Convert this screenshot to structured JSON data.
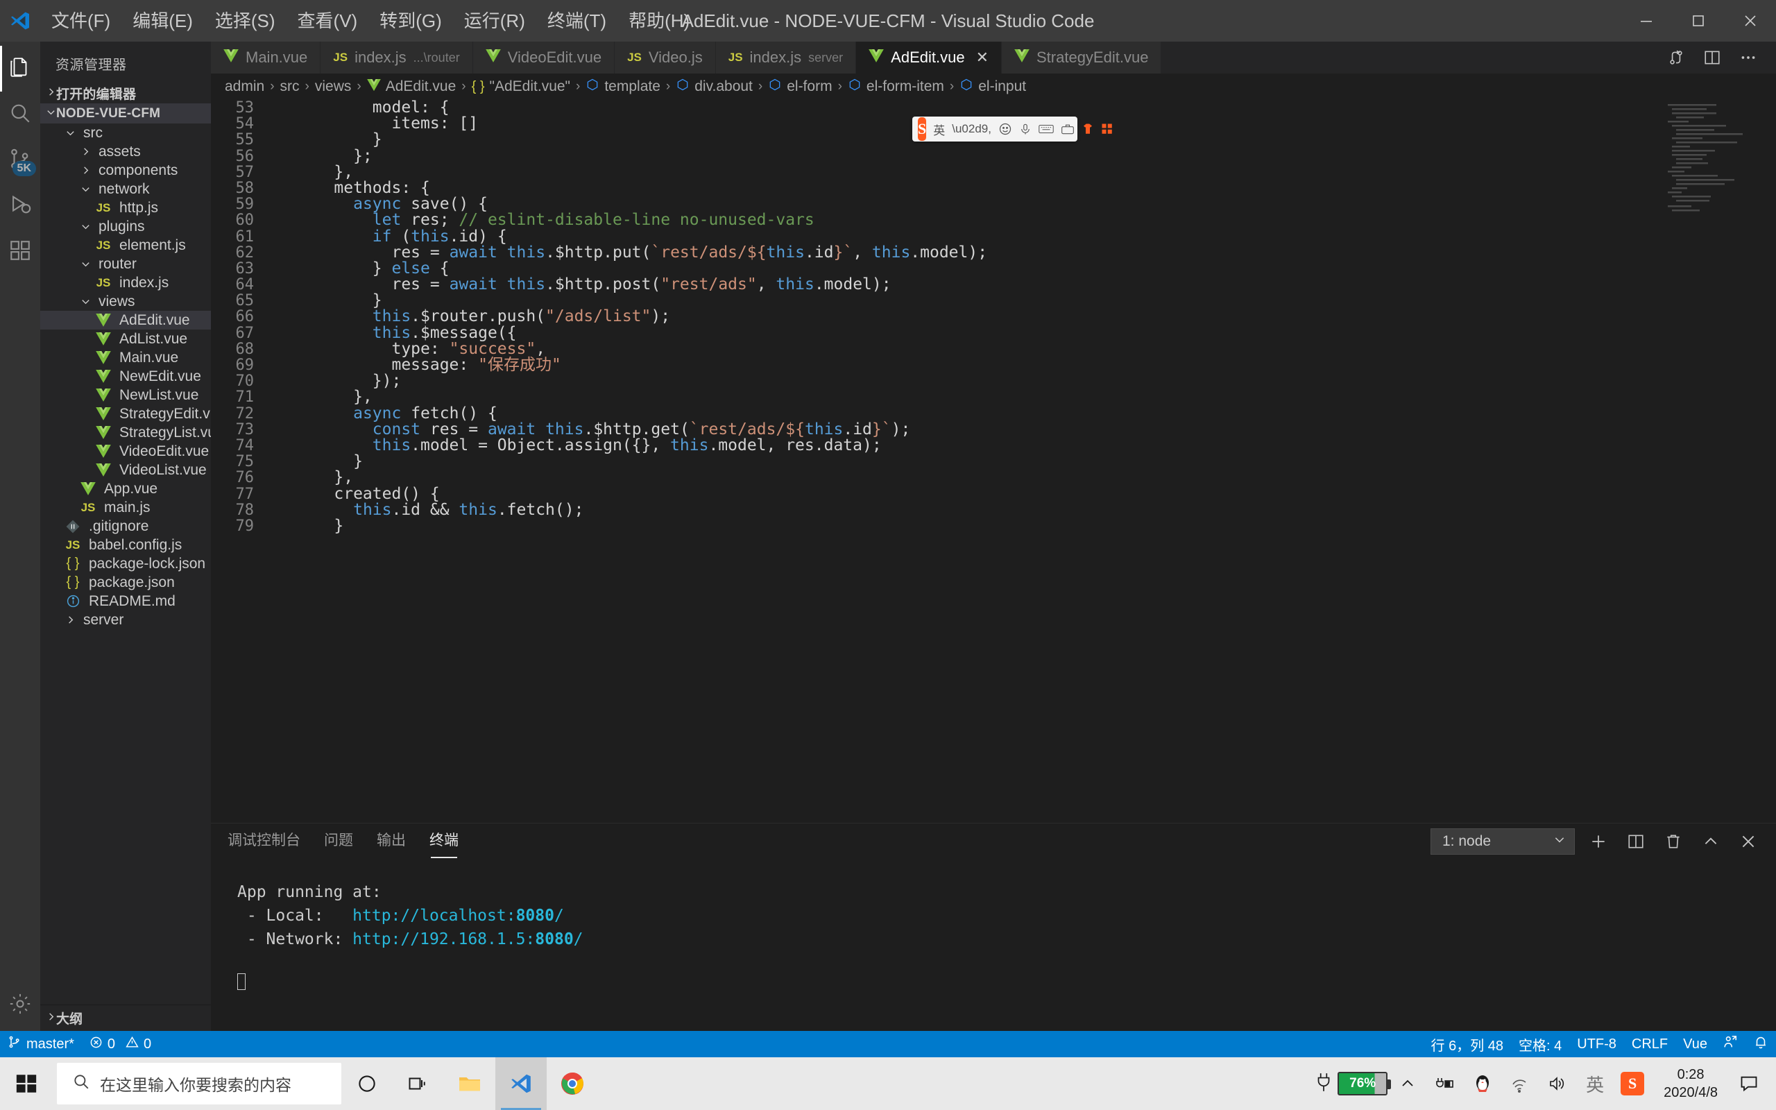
{
  "window": {
    "title": "AdEdit.vue - NODE-VUE-CFM - Visual Studio Code",
    "minimize": "—",
    "maximize": "❐",
    "close": "✕"
  },
  "menu": [
    {
      "label": "文件(F)",
      "name": "menu-file"
    },
    {
      "label": "编辑(E)",
      "name": "menu-edit"
    },
    {
      "label": "选择(S)",
      "name": "menu-selection"
    },
    {
      "label": "查看(V)",
      "name": "menu-view"
    },
    {
      "label": "转到(G)",
      "name": "menu-go"
    },
    {
      "label": "运行(R)",
      "name": "menu-run"
    },
    {
      "label": "终端(T)",
      "name": "menu-terminal"
    },
    {
      "label": "帮助(H)",
      "name": "menu-help"
    }
  ],
  "activitybar": {
    "source_control_badge": "5K"
  },
  "sidebar": {
    "title": "资源管理器",
    "sections": [
      {
        "label": "打开的编辑器",
        "expanded": false
      },
      {
        "label": "NODE-VUE-CFM",
        "expanded": true
      }
    ],
    "outline_label": "大纲",
    "tree": [
      {
        "label": "src",
        "indent": 1,
        "type": "folder",
        "expanded": true,
        "selected": false
      },
      {
        "label": "assets",
        "indent": 2,
        "type": "folder",
        "expanded": false,
        "selected": false
      },
      {
        "label": "components",
        "indent": 2,
        "type": "folder",
        "expanded": false,
        "selected": false
      },
      {
        "label": "network",
        "indent": 2,
        "type": "folder",
        "expanded": true,
        "selected": false
      },
      {
        "label": "http.js",
        "indent": 3,
        "type": "js",
        "selected": false
      },
      {
        "label": "plugins",
        "indent": 2,
        "type": "folder",
        "expanded": true,
        "selected": false
      },
      {
        "label": "element.js",
        "indent": 3,
        "type": "js",
        "selected": false
      },
      {
        "label": "router",
        "indent": 2,
        "type": "folder",
        "expanded": true,
        "selected": false
      },
      {
        "label": "index.js",
        "indent": 3,
        "type": "js",
        "selected": false
      },
      {
        "label": "views",
        "indent": 2,
        "type": "folder",
        "expanded": true,
        "selected": false
      },
      {
        "label": "AdEdit.vue",
        "indent": 3,
        "type": "vue",
        "selected": true
      },
      {
        "label": "AdList.vue",
        "indent": 3,
        "type": "vue",
        "selected": false
      },
      {
        "label": "Main.vue",
        "indent": 3,
        "type": "vue",
        "selected": false
      },
      {
        "label": "NewEdit.vue",
        "indent": 3,
        "type": "vue",
        "selected": false
      },
      {
        "label": "NewList.vue",
        "indent": 3,
        "type": "vue",
        "selected": false
      },
      {
        "label": "StrategyEdit.vue",
        "indent": 3,
        "type": "vue",
        "selected": false
      },
      {
        "label": "StrategyList.vue",
        "indent": 3,
        "type": "vue",
        "selected": false
      },
      {
        "label": "VideoEdit.vue",
        "indent": 3,
        "type": "vue",
        "selected": false
      },
      {
        "label": "VideoList.vue",
        "indent": 3,
        "type": "vue",
        "selected": false
      },
      {
        "label": "App.vue",
        "indent": 2,
        "type": "vue",
        "selected": false
      },
      {
        "label": "main.js",
        "indent": 2,
        "type": "js",
        "selected": false
      },
      {
        "label": ".gitignore",
        "indent": 1,
        "type": "git",
        "selected": false
      },
      {
        "label": "babel.config.js",
        "indent": 1,
        "type": "js",
        "selected": false
      },
      {
        "label": "package-lock.json",
        "indent": 1,
        "type": "json",
        "selected": false
      },
      {
        "label": "package.json",
        "indent": 1,
        "type": "json",
        "selected": false
      },
      {
        "label": "README.md",
        "indent": 1,
        "type": "info",
        "selected": false
      },
      {
        "label": "server",
        "indent": 1,
        "type": "folder",
        "expanded": false,
        "selected": false
      }
    ]
  },
  "tabs": [
    {
      "label": "Main.vue",
      "icon": "vue",
      "dim": "",
      "active": false,
      "closable": false
    },
    {
      "label": "index.js",
      "icon": "js",
      "dim": "...\\router",
      "active": false,
      "closable": false
    },
    {
      "label": "VideoEdit.vue",
      "icon": "vue",
      "dim": "",
      "active": false,
      "closable": false
    },
    {
      "label": "Video.js",
      "icon": "js",
      "dim": "",
      "active": false,
      "closable": false
    },
    {
      "label": "index.js",
      "icon": "js",
      "dim": "server",
      "active": false,
      "closable": false
    },
    {
      "label": "AdEdit.vue",
      "icon": "vue",
      "dim": "",
      "active": true,
      "closable": true
    },
    {
      "label": "StrategyEdit.vue",
      "icon": "vue",
      "dim": "",
      "active": false,
      "closable": false
    }
  ],
  "breadcrumb": [
    {
      "label": "admin",
      "icon": "none"
    },
    {
      "label": "src",
      "icon": "none"
    },
    {
      "label": "views",
      "icon": "none"
    },
    {
      "label": "AdEdit.vue",
      "icon": "vue"
    },
    {
      "label": "\"AdEdit.vue\"",
      "icon": "json"
    },
    {
      "label": "template",
      "icon": "cube"
    },
    {
      "label": "div.about",
      "icon": "cube"
    },
    {
      "label": "el-form",
      "icon": "cube"
    },
    {
      "label": "el-form-item",
      "icon": "cube"
    },
    {
      "label": "el-input",
      "icon": "cube"
    }
  ],
  "code": {
    "first_visible_line": 53,
    "lines": [
      {
        "n": 53,
        "tokens": [
          {
            "t": "        model: {",
            "c": "pun"
          }
        ],
        "clipped": true
      },
      {
        "n": 54,
        "tokens": [
          {
            "t": "          items: []",
            "c": "pun"
          }
        ]
      },
      {
        "n": 55,
        "tokens": [
          {
            "t": "        }",
            "c": "pun"
          }
        ]
      },
      {
        "n": 56,
        "tokens": [
          {
            "t": "      };",
            "c": "pun"
          }
        ]
      },
      {
        "n": 57,
        "tokens": [
          {
            "t": "    },",
            "c": "pun"
          }
        ]
      },
      {
        "n": 58,
        "tokens": [
          {
            "t": "    methods: {",
            "c": "pun"
          }
        ]
      },
      {
        "n": 59,
        "tokens": [
          {
            "t": "      ",
            "c": "pun"
          },
          {
            "t": "async",
            "c": "kw"
          },
          {
            "t": " save() {",
            "c": "pun"
          }
        ]
      },
      {
        "n": 60,
        "tokens": [
          {
            "t": "        ",
            "c": "pun"
          },
          {
            "t": "let",
            "c": "kw"
          },
          {
            "t": " res; ",
            "c": "pun"
          },
          {
            "t": "// eslint-disable-line no-unused-vars",
            "c": "cmt"
          }
        ]
      },
      {
        "n": 61,
        "tokens": [
          {
            "t": "        ",
            "c": "pun"
          },
          {
            "t": "if",
            "c": "kw"
          },
          {
            "t": " (",
            "c": "pun"
          },
          {
            "t": "this",
            "c": "kw"
          },
          {
            "t": ".id) {",
            "c": "pun"
          }
        ]
      },
      {
        "n": 62,
        "tokens": [
          {
            "t": "          res = ",
            "c": "pun"
          },
          {
            "t": "await",
            "c": "kw"
          },
          {
            "t": " ",
            "c": "pun"
          },
          {
            "t": "this",
            "c": "kw"
          },
          {
            "t": ".$http.put(",
            "c": "pun"
          },
          {
            "t": "`rest/ads/${",
            "c": "str"
          },
          {
            "t": "this",
            "c": "kw"
          },
          {
            "t": ".id",
            "c": "pun"
          },
          {
            "t": "}`",
            "c": "str"
          },
          {
            "t": ", ",
            "c": "pun"
          },
          {
            "t": "this",
            "c": "kw"
          },
          {
            "t": ".model);",
            "c": "pun"
          }
        ]
      },
      {
        "n": 63,
        "tokens": [
          {
            "t": "        } ",
            "c": "pun"
          },
          {
            "t": "else",
            "c": "kw"
          },
          {
            "t": " {",
            "c": "pun"
          }
        ]
      },
      {
        "n": 64,
        "tokens": [
          {
            "t": "          res = ",
            "c": "pun"
          },
          {
            "t": "await",
            "c": "kw"
          },
          {
            "t": " ",
            "c": "pun"
          },
          {
            "t": "this",
            "c": "kw"
          },
          {
            "t": ".$http.post(",
            "c": "pun"
          },
          {
            "t": "\"rest/ads\"",
            "c": "str"
          },
          {
            "t": ", ",
            "c": "pun"
          },
          {
            "t": "this",
            "c": "kw"
          },
          {
            "t": ".model);",
            "c": "pun"
          }
        ]
      },
      {
        "n": 65,
        "tokens": [
          {
            "t": "        }",
            "c": "pun"
          }
        ]
      },
      {
        "n": 66,
        "tokens": [
          {
            "t": "        ",
            "c": "pun"
          },
          {
            "t": "this",
            "c": "kw"
          },
          {
            "t": ".$router.push(",
            "c": "pun"
          },
          {
            "t": "\"/ads/list\"",
            "c": "str"
          },
          {
            "t": ");",
            "c": "pun"
          }
        ]
      },
      {
        "n": 67,
        "tokens": [
          {
            "t": "        ",
            "c": "pun"
          },
          {
            "t": "this",
            "c": "kw"
          },
          {
            "t": ".$message({",
            "c": "pun"
          }
        ]
      },
      {
        "n": 68,
        "tokens": [
          {
            "t": "          type: ",
            "c": "pun"
          },
          {
            "t": "\"success\"",
            "c": "str"
          },
          {
            "t": ",",
            "c": "pun"
          }
        ]
      },
      {
        "n": 69,
        "tokens": [
          {
            "t": "          message: ",
            "c": "pun"
          },
          {
            "t": "\"保存成功\"",
            "c": "str"
          }
        ]
      },
      {
        "n": 70,
        "tokens": [
          {
            "t": "        });",
            "c": "pun"
          }
        ]
      },
      {
        "n": 71,
        "tokens": [
          {
            "t": "      },",
            "c": "pun"
          }
        ]
      },
      {
        "n": 72,
        "tokens": [
          {
            "t": "      ",
            "c": "pun"
          },
          {
            "t": "async",
            "c": "kw"
          },
          {
            "t": " fetch() {",
            "c": "pun"
          }
        ]
      },
      {
        "n": 73,
        "tokens": [
          {
            "t": "        ",
            "c": "pun"
          },
          {
            "t": "const",
            "c": "kw"
          },
          {
            "t": " res = ",
            "c": "pun"
          },
          {
            "t": "await",
            "c": "kw"
          },
          {
            "t": " ",
            "c": "pun"
          },
          {
            "t": "this",
            "c": "kw"
          },
          {
            "t": ".$http.get(",
            "c": "pun"
          },
          {
            "t": "`rest/ads/${",
            "c": "str"
          },
          {
            "t": "this",
            "c": "kw"
          },
          {
            "t": ".id",
            "c": "pun"
          },
          {
            "t": "}`",
            "c": "str"
          },
          {
            "t": ");",
            "c": "pun"
          }
        ]
      },
      {
        "n": 74,
        "tokens": [
          {
            "t": "        ",
            "c": "pun"
          },
          {
            "t": "this",
            "c": "kw"
          },
          {
            "t": ".model = Object.assign({}, ",
            "c": "pun"
          },
          {
            "t": "this",
            "c": "kw"
          },
          {
            "t": ".model, res.data);",
            "c": "pun"
          }
        ]
      },
      {
        "n": 75,
        "tokens": [
          {
            "t": "      }",
            "c": "pun"
          }
        ]
      },
      {
        "n": 76,
        "tokens": [
          {
            "t": "    },",
            "c": "pun"
          }
        ]
      },
      {
        "n": 77,
        "tokens": [
          {
            "t": "    created() {",
            "c": "pun"
          }
        ]
      },
      {
        "n": 78,
        "tokens": [
          {
            "t": "      ",
            "c": "pun"
          },
          {
            "t": "this",
            "c": "kw"
          },
          {
            "t": ".id && ",
            "c": "pun"
          },
          {
            "t": "this",
            "c": "kw"
          },
          {
            "t": ".fetch();",
            "c": "pun"
          }
        ]
      },
      {
        "n": 79,
        "tokens": [
          {
            "t": "    }",
            "c": "pun"
          }
        ],
        "clipped": true
      }
    ]
  },
  "panel": {
    "tabs": [
      {
        "label": "调试控制台",
        "active": false
      },
      {
        "label": "问题",
        "active": false
      },
      {
        "label": "输出",
        "active": false
      },
      {
        "label": "终端",
        "active": true
      }
    ],
    "terminal_select": "1: node",
    "terminal_lines": [
      {
        "segments": [
          {
            "t": "App running at:",
            "c": "plain"
          }
        ]
      },
      {
        "segments": [
          {
            "t": " - Local:   ",
            "c": "plain"
          },
          {
            "t": "http://localhost:",
            "c": "link"
          },
          {
            "t": "8080",
            "c": "bold"
          },
          {
            "t": "/",
            "c": "link"
          }
        ]
      },
      {
        "segments": [
          {
            "t": " - Network: ",
            "c": "plain"
          },
          {
            "t": "http://192.168.1.5:",
            "c": "link"
          },
          {
            "t": "8080",
            "c": "bold"
          },
          {
            "t": "/",
            "c": "link"
          }
        ]
      }
    ]
  },
  "statusbar": {
    "branch": "master*",
    "errors": "0",
    "warnings": "0",
    "cursor": "行 6，列 48",
    "indent": "空格: 4",
    "encoding": "UTF-8",
    "eol": "CRLF",
    "language": "Vue",
    "accent_color": "#007acc"
  },
  "taskbar": {
    "search_placeholder": "在这里输入你要搜索的内容",
    "battery_percent": "76%",
    "ime_label": "英",
    "clock_time": "0:28",
    "clock_date": "2020/4/8"
  },
  "ime_bar": {
    "logo": "S",
    "mode": "英"
  }
}
